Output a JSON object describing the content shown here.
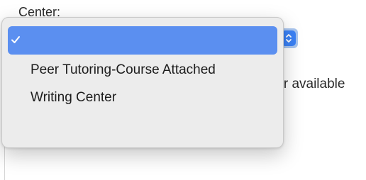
{
  "form": {
    "center_label": "Center:",
    "background_text": "for available"
  },
  "dropdown": {
    "options": [
      {
        "label": "",
        "selected": true
      },
      {
        "label": "Peer Tutoring-Course Attached",
        "selected": false
      },
      {
        "label": "Writing Center",
        "selected": false
      }
    ]
  },
  "colors": {
    "selection": "#5b8ff0",
    "stepper": "#3b82f6",
    "menu_background": "#ececec"
  },
  "icons": {
    "checkmark": "checkmark-icon",
    "stepper": "updown-chevron-icon"
  }
}
